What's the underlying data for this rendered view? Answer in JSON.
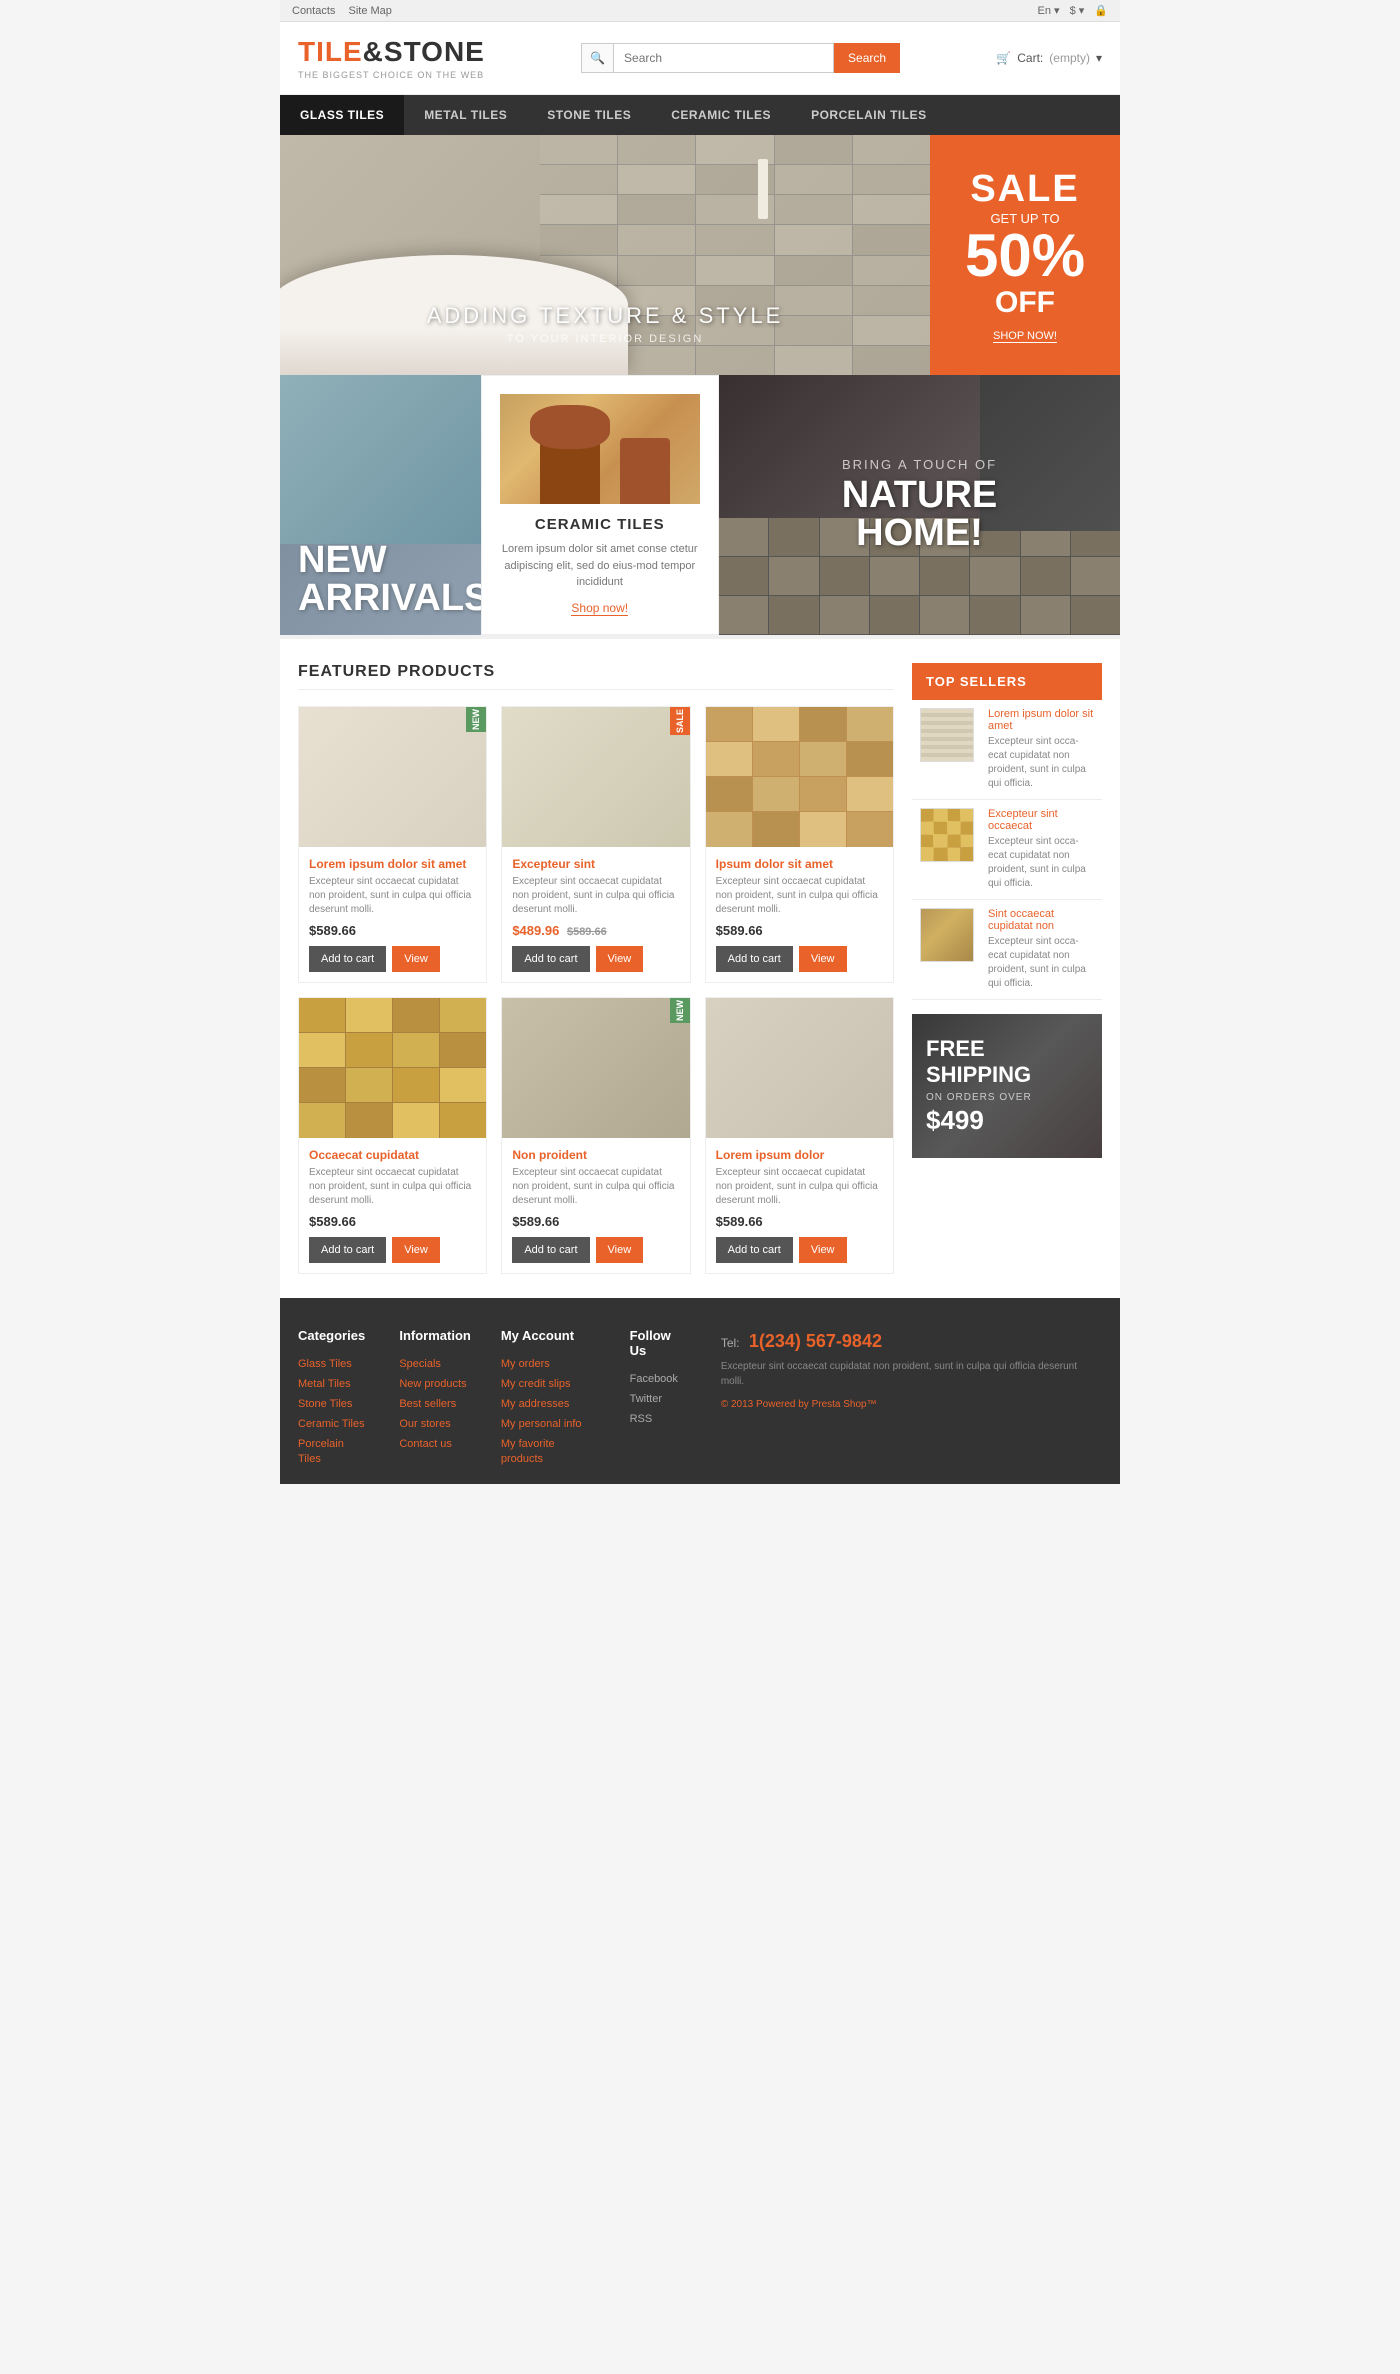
{
  "topbar": {
    "left_links": [
      "Contacts",
      "Site Map"
    ],
    "right_items": [
      "En ▾",
      "$ ▾",
      "🔒"
    ]
  },
  "header": {
    "logo_name_1": "TILE",
    "logo_amp": "&",
    "logo_name_2": "STONE",
    "logo_tagline": "THE BIGGEST CHOICE ON THE WEB",
    "search_placeholder": "Search",
    "search_button": "Search",
    "cart_label": "Cart:",
    "cart_status": "(empty)"
  },
  "nav": {
    "items": [
      {
        "label": "GLASS TILES",
        "active": true
      },
      {
        "label": "METAL TILES",
        "active": false
      },
      {
        "label": "STONE TILES",
        "active": false
      },
      {
        "label": "CERAMIC TILES",
        "active": false
      },
      {
        "label": "PORCELAIN TILES",
        "active": false
      }
    ]
  },
  "hero": {
    "headline": "ADDING TEXTURE & STYLE",
    "subheadline": "TO YOUR INTERIOR DESIGN",
    "sale_word": "SALE",
    "sale_get": "GET UP TO",
    "sale_pct": "50%",
    "sale_off": "OFF",
    "sale_cta": "SHOP NOW!"
  },
  "promo": {
    "new_arrivals_line1": "NEW",
    "new_arrivals_line2": "ARRIVALS",
    "ceramic_title": "CERAMIC TILES",
    "ceramic_desc": "Lorem ipsum dolor sit amet conse ctetur adipiscing elit, sed do eius-mod tempor incididunt",
    "ceramic_link": "Shop now!",
    "nature_sub": "BRING A TOUCH OF",
    "nature_headline_line1": "NATURE",
    "nature_headline_line2": "HOME!"
  },
  "featured": {
    "title": "FEATURED PRODUCTS",
    "products": [
      {
        "id": 1,
        "badge": "NEW",
        "badge_type": "new",
        "name": "Lorem ipsum dolor sit amet",
        "desc": "Excepteur sint occaecat cupidatat non proident, sunt in culpa qui officia deserunt molli.",
        "price": "$589.66",
        "old_price": null,
        "sale_price": null
      },
      {
        "id": 2,
        "badge": "SALE",
        "badge_type": "sale",
        "name": "Excepteur sint",
        "desc": "Excepteur sint occaecat cupidatat non proident, sunt in culpa qui officia deserunt molli.",
        "price": "$589.66",
        "old_price": "$589.66",
        "sale_price": "$489.96"
      },
      {
        "id": 3,
        "badge": null,
        "badge_type": null,
        "name": "Ipsum dolor sit amet",
        "desc": "Excepteur sint occaecat cupidatat non proident, sunt in culpa qui officia deserunt molli.",
        "price": "$589.66",
        "old_price": null,
        "sale_price": null
      },
      {
        "id": 4,
        "badge": null,
        "badge_type": null,
        "name": "Occaecat cupidatat",
        "desc": "Excepteur sint occaecat cupidatat non proident, sunt in culpa qui officia deserunt molli.",
        "price": "$589.66",
        "old_price": null,
        "sale_price": null
      },
      {
        "id": 5,
        "badge": "NEW",
        "badge_type": "new",
        "name": "Non proident",
        "desc": "Excepteur sint occaecat cupidatat non proident, sunt in culpa qui officia deserunt molli.",
        "price": "$589.66",
        "old_price": null,
        "sale_price": null
      },
      {
        "id": 6,
        "badge": null,
        "badge_type": null,
        "name": "Lorem ipsum dolor",
        "desc": "Excepteur sint occaecat cupidatat non proident, sunt in culpa qui officia deserunt molli.",
        "price": "$589.66",
        "old_price": null,
        "sale_price": null
      }
    ],
    "btn_cart": "Add to cart",
    "btn_view": "View"
  },
  "top_sellers": {
    "title": "TOP SELLERS",
    "items": [
      {
        "name": "Lorem ipsum dolor sit amet",
        "desc": "Excepteur sint occa-ecat cupidatat non proident, sunt in culpa qui officia."
      },
      {
        "name": "Excepteur sint occaecat",
        "desc": "Excepteur sint occa-ecat cupidatat non proident, sunt in culpa qui officia."
      },
      {
        "name": "Sint occaecat cupidatat non",
        "desc": "Excepteur sint occa-ecat cupidatat non proident, sunt in culpa qui officia."
      }
    ]
  },
  "free_shipping": {
    "line1": "FREE",
    "line2": "SHIPPING",
    "desc": "ON ORDERS OVER",
    "amount": "$499"
  },
  "footer": {
    "categories_title": "Categories",
    "categories": [
      "Glass Tiles",
      "Metal Tiles",
      "Stone Tiles",
      "Ceramic Tiles",
      "Porcelain Tiles"
    ],
    "information_title": "Information",
    "information": [
      "Specials",
      "New products",
      "Best sellers",
      "Our stores",
      "Contact us"
    ],
    "account_title": "My Account",
    "account": [
      "My orders",
      "My credit slips",
      "My addresses",
      "My personal info",
      "My favorite products"
    ],
    "follow_title": "Follow us",
    "follow": [
      "Facebook",
      "Twitter",
      "RSS"
    ],
    "tel_label": "Tel:",
    "tel": "1(234) 567-9842",
    "tel_desc": "Excepteur sint occaecat cupidatat non proident, sunt in culpa qui officia deserunt molli.",
    "copyright": "© 2013 Powered by Presta Shop™"
  }
}
